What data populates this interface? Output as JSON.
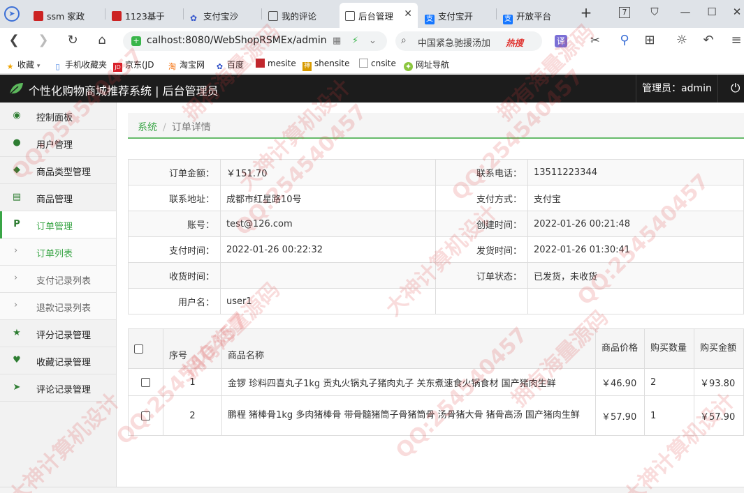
{
  "browser": {
    "tabs": [
      {
        "label": "ssm 家政",
        "fav_color": "#cc2222"
      },
      {
        "label": "1123基于",
        "fav_color": "#cc2222"
      },
      {
        "label": "支付宝沙",
        "fav_color": "#ffffff"
      },
      {
        "label": "我的评论",
        "fav_color": "#ffffff"
      },
      {
        "label": "后台管理",
        "fav_color": "#ffffff",
        "active": true
      },
      {
        "label": "支付宝开",
        "fav_color": "#1677ff"
      },
      {
        "label": "开放平台",
        "fav_color": "#1677ff"
      }
    ],
    "url": "calhost:8080/WebShopRSMEx/admin",
    "search_text": "中国紧急驰援汤加",
    "search_hot": "热搜",
    "translate_label": "译",
    "bookmarks": [
      {
        "label": "收藏",
        "icon": "star-icon"
      },
      {
        "label": "手机收藏夹",
        "icon": "phone-icon"
      },
      {
        "label": "京东(JD",
        "icon": "jd-icon"
      },
      {
        "label": "淘宝网",
        "icon": "taobao-icon"
      },
      {
        "label": "百度",
        "icon": "baidu-icon"
      },
      {
        "label": "mesite",
        "icon": "site-icon"
      },
      {
        "label": "shensite",
        "icon": "site-icon"
      },
      {
        "label": "cnsite",
        "icon": "page-icon"
      },
      {
        "label": "网址导航",
        "icon": "nav-icon"
      }
    ]
  },
  "header": {
    "title": "个性化购物商城推荐系统 | 后台管理员",
    "admin_label": "管理员：admin"
  },
  "sidebar": {
    "items": [
      {
        "label": "控制面板",
        "icon": "dashboard-icon",
        "glyph": "◉"
      },
      {
        "label": "用户管理",
        "icon": "user-icon",
        "glyph": "●"
      },
      {
        "label": "商品类型管理",
        "icon": "tags-icon",
        "glyph": "◆"
      },
      {
        "label": "商品管理",
        "icon": "list-icon",
        "glyph": "▤"
      },
      {
        "label": "订单管理",
        "icon": "paypal-icon",
        "glyph": "P",
        "active": true
      },
      {
        "label": "订单列表",
        "sub": true,
        "current": true
      },
      {
        "label": "支付记录列表",
        "sub": true
      },
      {
        "label": "退款记录列表",
        "sub": true
      },
      {
        "label": "评分记录管理",
        "icon": "star-icon",
        "glyph": "★"
      },
      {
        "label": "收藏记录管理",
        "icon": "heart-icon",
        "glyph": "♥"
      },
      {
        "label": "评论记录管理",
        "icon": "send-icon",
        "glyph": "➤"
      }
    ]
  },
  "breadcrumb": {
    "root": "系统",
    "sep": "/",
    "current": "订单详情"
  },
  "order": {
    "rows": [
      {
        "l1": "订单金额：",
        "v1": "￥151.70",
        "l2": "联系电话：",
        "v2": "13511223344"
      },
      {
        "l1": "联系地址：",
        "v1": "成都市红星路10号",
        "l2": "支付方式：",
        "v2": "支付宝"
      },
      {
        "l1": "账号：",
        "v1": "test@126.com",
        "l2": "创建时间：",
        "v2": "2022-01-26 00:21:48"
      },
      {
        "l1": "支付时间：",
        "v1": "2022-01-26 00:22:32",
        "l2": "发货时间：",
        "v2": "2022-01-26 01:30:41"
      },
      {
        "l1": "收货时间：",
        "v1": "",
        "l2": "订单状态：",
        "v2": "已发货，未收货"
      },
      {
        "l1": "用户名：",
        "v1": "user1",
        "l2": "",
        "v2": ""
      }
    ]
  },
  "items": {
    "headers": {
      "seq": "序号",
      "name": "商品名称",
      "price": "商品价格",
      "qty": "购买数量",
      "amount": "购买金额"
    },
    "rows": [
      {
        "seq": "1",
        "name": "金锣 珍料四喜丸子1kg 贡丸火锅丸子猪肉丸子 关东煮速食火锅食材 国产猪肉生鲜",
        "price": "￥46.90",
        "qty": "2",
        "amount": "￥93.80"
      },
      {
        "seq": "2",
        "name": "鹏程 猪棒骨1kg 多肉猪棒骨 带骨髓猪筒子骨猪筒骨 汤骨猪大骨 猪骨高汤 国产猪肉生鲜",
        "price": "￥57.90",
        "qty": "1",
        "amount": "￥57.90"
      }
    ]
  },
  "watermark": {
    "texts": [
      "QQ:254540457",
      "大神计算机设计",
      "拥有海量源码"
    ]
  },
  "colors": {
    "accent": "#39a546",
    "header_bg": "#1c1c1c",
    "sidebar_bg": "#f2f2f2"
  }
}
